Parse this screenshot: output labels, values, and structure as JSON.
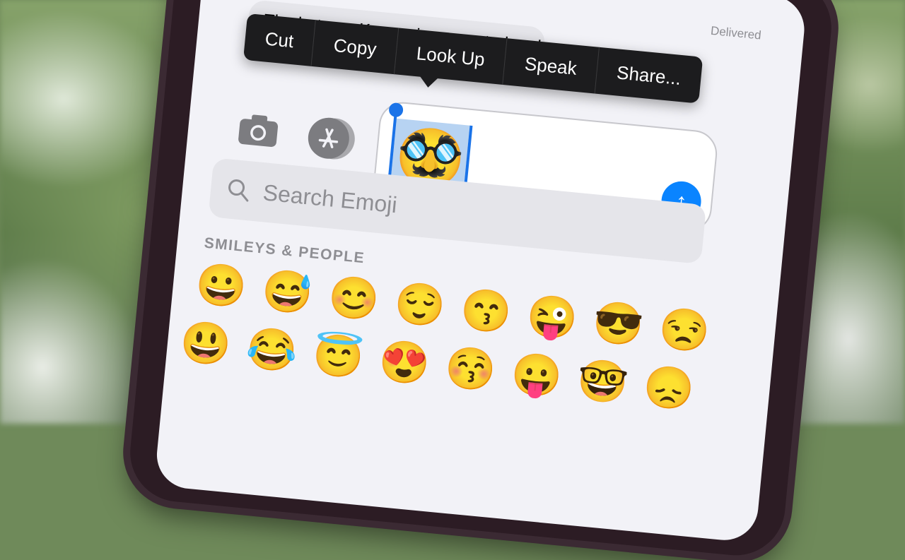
{
  "status": {
    "delivered": "Delivered"
  },
  "thread": {
    "message_preview": "The hate on Kuzma is warranted and"
  },
  "context_menu": {
    "items": [
      "Cut",
      "Copy",
      "Look Up",
      "Speak",
      "Share..."
    ]
  },
  "composer": {
    "selected_emoji": "🥸",
    "camera_icon": "camera-icon",
    "appstore_icon": "app-store-icon",
    "send_icon": "arrow-up-icon",
    "send_glyph": "↑"
  },
  "emoji_keyboard": {
    "search_placeholder": "Search Emoji",
    "section_title": "SMILEYS & PEOPLE",
    "rows": [
      [
        "😀",
        "😅",
        "😊",
        "😌",
        "😙",
        "😜",
        "😎",
        "😒"
      ],
      [
        "😃",
        "😂",
        "😇",
        "😍",
        "😚",
        "😛",
        "🤓",
        "😞"
      ]
    ]
  },
  "colors": {
    "accent": "#0a84ff",
    "menu_bg": "#1c1c1e",
    "selection": "#b7d3f2"
  }
}
